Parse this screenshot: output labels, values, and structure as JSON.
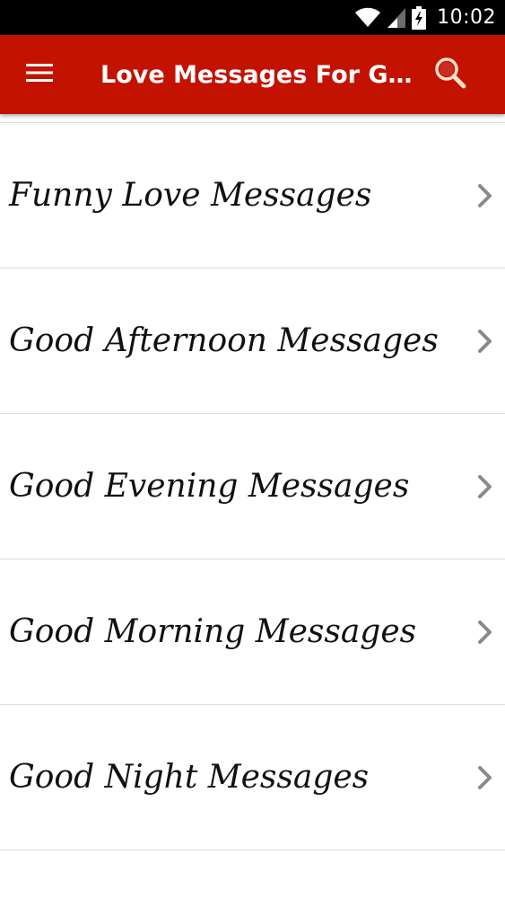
{
  "status_bar": {
    "time": "10:02",
    "icons": [
      "wifi-icon",
      "cell-signal-icon",
      "battery-charging-icon"
    ]
  },
  "app_bar": {
    "title": "Love Messages For Gir...",
    "menu_icon": "hamburger-menu-icon",
    "search_icon": "search-icon",
    "background_color": "#c41200"
  },
  "list": {
    "items": [
      {
        "label": "Funny Love Messages"
      },
      {
        "label": "Good Afternoon Messages"
      },
      {
        "label": "Good Evening Messages"
      },
      {
        "label": "Good Morning Messages"
      },
      {
        "label": "Good Night Messages"
      }
    ],
    "chevron_icon": "chevron-right-icon",
    "chevron_color": "#8a8a8a"
  }
}
